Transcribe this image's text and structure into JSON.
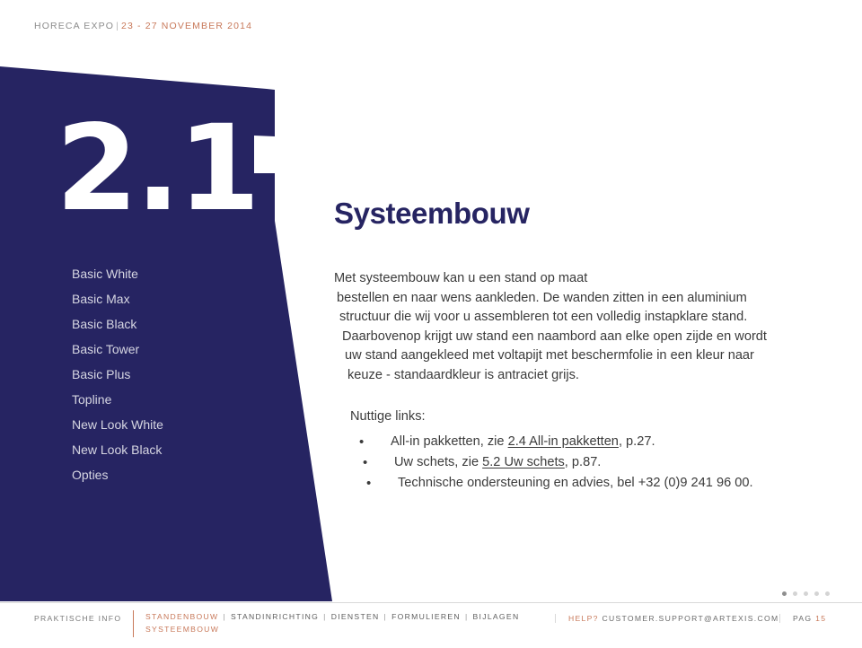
{
  "header": {
    "brand": "HORECA EXPO",
    "separator": "|",
    "dates": "23 - 27 NOVEMBER 2014"
  },
  "section": {
    "number": "2.1",
    "title": "Systeembouw"
  },
  "sidebar": {
    "items": [
      {
        "label": "Basic White"
      },
      {
        "label": "Basic Max"
      },
      {
        "label": "Basic Black"
      },
      {
        "label": "Basic Tower"
      },
      {
        "label": "Basic Plus"
      },
      {
        "label": "Topline"
      },
      {
        "label": "New Look White"
      },
      {
        "label": "New Look Black"
      },
      {
        "label": "Opties"
      }
    ]
  },
  "body": {
    "lines": [
      "Met systeembouw kan u een stand op maat",
      "bestellen en naar wens aankleden. De wanden zitten in een aluminium",
      "structuur die wij voor u assembleren tot een volledig instapklare stand.",
      "Daarbovenop krijgt uw stand een naambord aan elke open zijde en wordt",
      "uw stand aangekleed met voltapijt met beschermfolie in een kleur naar",
      "keuze - standaardkleur is antraciet grijs."
    ]
  },
  "links": {
    "heading": "Nuttige links:",
    "bullet_glyph": "•",
    "items": [
      {
        "before": "All-in pakketten, zie ",
        "xref": "2.4 All-in pakketten",
        "after": ", p.27."
      },
      {
        "before": "Uw schets, zie ",
        "xref": "5.2 Uw schets",
        "after": ", p.87."
      },
      {
        "before": "Technische ondersteuning en advies, bel +32 (0)9 241 96 00.",
        "xref": "",
        "after": ""
      }
    ]
  },
  "pagination": {
    "dots_total": 5,
    "dots_active_index": 0
  },
  "footer": {
    "left_label": "PRAKTISCHE INFO",
    "crumbs_line1": [
      {
        "label": "STANDENBOUW",
        "active": true
      },
      {
        "label": "STANDINRICHTING",
        "active": false
      },
      {
        "label": "DIENSTEN",
        "active": false
      },
      {
        "label": "FORMULIEREN",
        "active": false
      },
      {
        "label": "BIJLAGEN",
        "active": false
      }
    ],
    "crumb_separator": "|",
    "crumbs_line2": "SYSTEEMBOUW",
    "help_label": "HELP?",
    "help_email": "CUSTOMER.SUPPORT@ARTEXIS.COM",
    "page_label": "PAG",
    "page_number": "15"
  },
  "colors": {
    "navy": "#262462",
    "accent_orange": "#c8795a",
    "body_text": "#3b3b3b",
    "sidebar_text": "#d6d6e2",
    "page": "#ffffff"
  }
}
